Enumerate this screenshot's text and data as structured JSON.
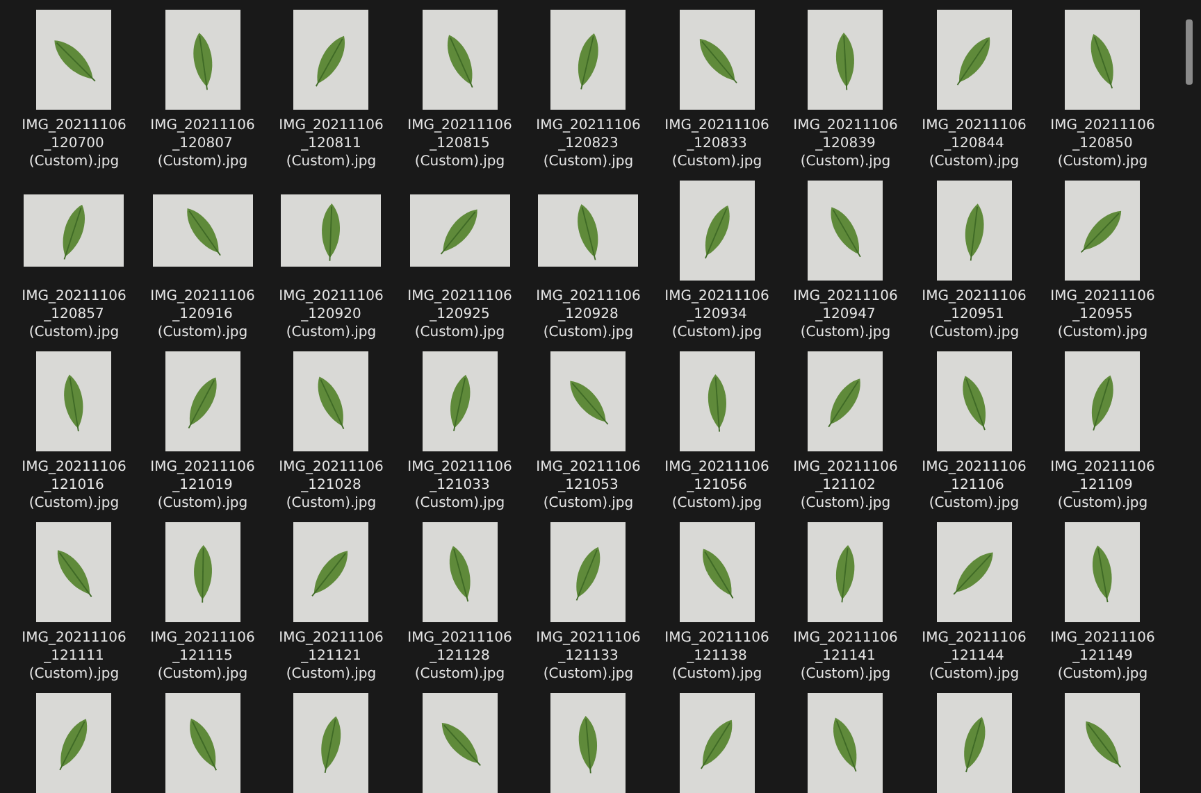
{
  "files": [
    {
      "kind": "portrait",
      "name_lines": [
        "IMG_20211106",
        "_120700",
        "(Custom).jpg"
      ]
    },
    {
      "kind": "portrait",
      "name_lines": [
        "IMG_20211106",
        "_120807",
        "(Custom).jpg"
      ]
    },
    {
      "kind": "portrait",
      "name_lines": [
        "IMG_20211106",
        "_120811",
        "(Custom).jpg"
      ]
    },
    {
      "kind": "portrait",
      "name_lines": [
        "IMG_20211106",
        "_120815",
        "(Custom).jpg"
      ]
    },
    {
      "kind": "portrait",
      "name_lines": [
        "IMG_20211106",
        "_120823",
        "(Custom).jpg"
      ]
    },
    {
      "kind": "portrait",
      "name_lines": [
        "IMG_20211106",
        "_120833",
        "(Custom).jpg"
      ]
    },
    {
      "kind": "portrait",
      "name_lines": [
        "IMG_20211106",
        "_120839",
        "(Custom).jpg"
      ]
    },
    {
      "kind": "portrait",
      "name_lines": [
        "IMG_20211106",
        "_120844",
        "(Custom).jpg"
      ]
    },
    {
      "kind": "portrait",
      "name_lines": [
        "IMG_20211106",
        "_120850",
        "(Custom).jpg"
      ]
    },
    {
      "kind": "landscape",
      "name_lines": [
        "IMG_20211106",
        "_120857",
        "(Custom).jpg"
      ]
    },
    {
      "kind": "landscape",
      "name_lines": [
        "IMG_20211106",
        "_120916",
        "(Custom).jpg"
      ]
    },
    {
      "kind": "landscape",
      "name_lines": [
        "IMG_20211106",
        "_120920",
        "(Custom).jpg"
      ]
    },
    {
      "kind": "landscape",
      "name_lines": [
        "IMG_20211106",
        "_120925",
        "(Custom).jpg"
      ]
    },
    {
      "kind": "landscape",
      "name_lines": [
        "IMG_20211106",
        "_120928",
        "(Custom).jpg"
      ]
    },
    {
      "kind": "portrait",
      "name_lines": [
        "IMG_20211106",
        "_120934",
        "(Custom).jpg"
      ]
    },
    {
      "kind": "portrait",
      "name_lines": [
        "IMG_20211106",
        "_120947",
        "(Custom).jpg"
      ]
    },
    {
      "kind": "portrait",
      "name_lines": [
        "IMG_20211106",
        "_120951",
        "(Custom).jpg"
      ]
    },
    {
      "kind": "portrait",
      "name_lines": [
        "IMG_20211106",
        "_120955",
        "(Custom).jpg"
      ]
    },
    {
      "kind": "portrait",
      "name_lines": [
        "IMG_20211106",
        "_121016",
        "(Custom).jpg"
      ]
    },
    {
      "kind": "portrait",
      "name_lines": [
        "IMG_20211106",
        "_121019",
        "(Custom).jpg"
      ]
    },
    {
      "kind": "portrait",
      "name_lines": [
        "IMG_20211106",
        "_121028",
        "(Custom).jpg"
      ]
    },
    {
      "kind": "portrait",
      "name_lines": [
        "IMG_20211106",
        "_121033",
        "(Custom).jpg"
      ]
    },
    {
      "kind": "portrait",
      "name_lines": [
        "IMG_20211106",
        "_121053",
        "(Custom).jpg"
      ]
    },
    {
      "kind": "portrait",
      "name_lines": [
        "IMG_20211106",
        "_121056",
        "(Custom).jpg"
      ]
    },
    {
      "kind": "portrait",
      "name_lines": [
        "IMG_20211106",
        "_121102",
        "(Custom).jpg"
      ]
    },
    {
      "kind": "portrait",
      "name_lines": [
        "IMG_20211106",
        "_121106",
        "(Custom).jpg"
      ]
    },
    {
      "kind": "portrait",
      "name_lines": [
        "IMG_20211106",
        "_121109",
        "(Custom).jpg"
      ]
    },
    {
      "kind": "portrait",
      "name_lines": [
        "IMG_20211106",
        "_121111",
        "(Custom).jpg"
      ]
    },
    {
      "kind": "portrait",
      "name_lines": [
        "IMG_20211106",
        "_121115",
        "(Custom).jpg"
      ]
    },
    {
      "kind": "portrait",
      "name_lines": [
        "IMG_20211106",
        "_121121",
        "(Custom).jpg"
      ]
    },
    {
      "kind": "portrait",
      "name_lines": [
        "IMG_20211106",
        "_121128",
        "(Custom).jpg"
      ]
    },
    {
      "kind": "portrait",
      "name_lines": [
        "IMG_20211106",
        "_121133",
        "(Custom).jpg"
      ]
    },
    {
      "kind": "portrait",
      "name_lines": [
        "IMG_20211106",
        "_121138",
        "(Custom).jpg"
      ]
    },
    {
      "kind": "portrait",
      "name_lines": [
        "IMG_20211106",
        "_121141",
        "(Custom).jpg"
      ]
    },
    {
      "kind": "portrait",
      "name_lines": [
        "IMG_20211106",
        "_121144",
        "(Custom).jpg"
      ]
    },
    {
      "kind": "portrait",
      "name_lines": [
        "IMG_20211106",
        "_121149",
        "(Custom).jpg"
      ]
    },
    {
      "kind": "portrait"
    },
    {
      "kind": "portrait"
    },
    {
      "kind": "portrait"
    },
    {
      "kind": "portrait"
    },
    {
      "kind": "portrait"
    },
    {
      "kind": "portrait"
    },
    {
      "kind": "portrait"
    },
    {
      "kind": "portrait"
    },
    {
      "kind": "portrait"
    }
  ]
}
